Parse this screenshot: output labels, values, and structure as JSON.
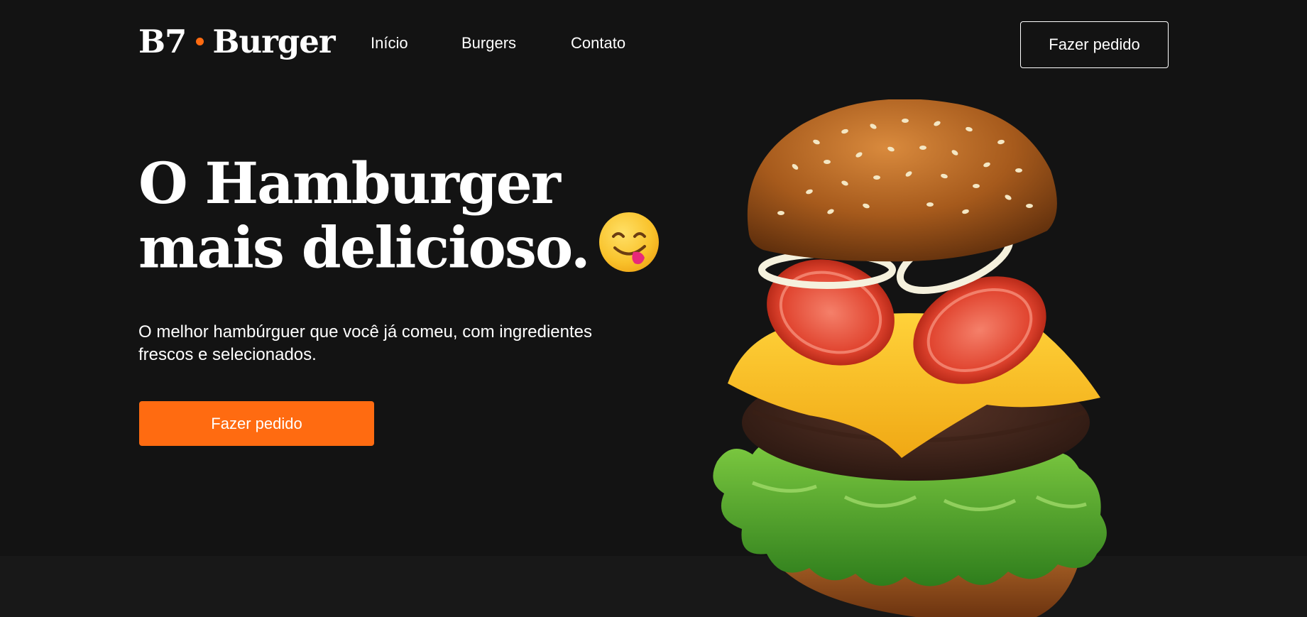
{
  "header": {
    "logo_left": "B7",
    "logo_right": "Burger",
    "nav": [
      {
        "label": "Início"
      },
      {
        "label": "Burgers"
      },
      {
        "label": "Contato"
      }
    ],
    "cta_label": "Fazer pedido"
  },
  "hero": {
    "title_line1": "O Hamburger",
    "title_line2": "mais delicioso.",
    "title_emoji": "face-savoring-food-icon",
    "subtitle": "O melhor hambúrguer que você já comeu, com ingredientes frescos e selecionados.",
    "cta_label": "Fazer pedido",
    "image": "burger-image"
  },
  "colors": {
    "background": "#131313",
    "accent": "#ff6b11",
    "text": "#ffffff"
  }
}
